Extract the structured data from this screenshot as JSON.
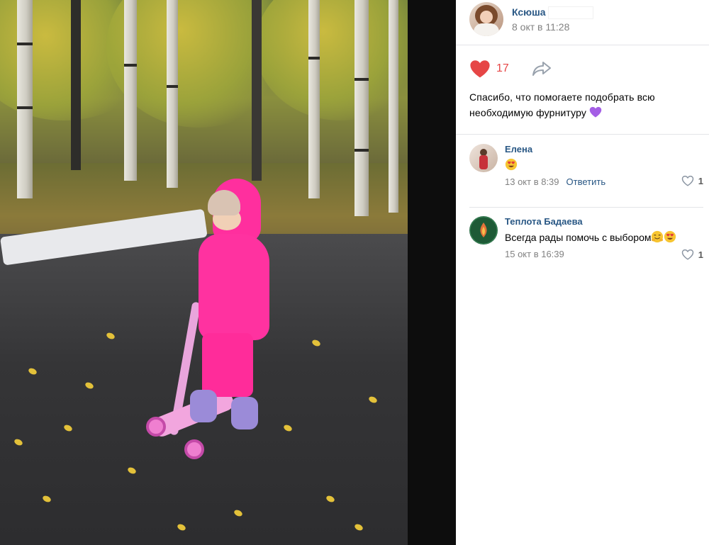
{
  "post": {
    "author_name": "Ксюша",
    "date": "8 окт в 11:28",
    "likes": "17",
    "text": "Спасибо, что помогаете подобрать всю необходимую фурнитуру"
  },
  "comments": [
    {
      "name": "Елена",
      "text": "",
      "date": "13 окт в 8:39",
      "reply_label": "Ответить",
      "likes": "1"
    },
    {
      "name": "Теплота Бадаева",
      "text": "Всегда рады помочь с выбором",
      "date": "15 окт в 16:39",
      "likes": "1"
    }
  ],
  "icons": {
    "like": "heart-icon",
    "share": "share-arrow-icon",
    "comment_like": "heart-outline-icon",
    "emoji_purple_heart": "purple-heart-emoji",
    "emoji_heart_eyes": "heart-eyes-emoji",
    "emoji_hugging": "hugging-face-emoji"
  },
  "colors": {
    "link": "#2a5885",
    "like_active": "#e64646",
    "meta": "#828282"
  }
}
